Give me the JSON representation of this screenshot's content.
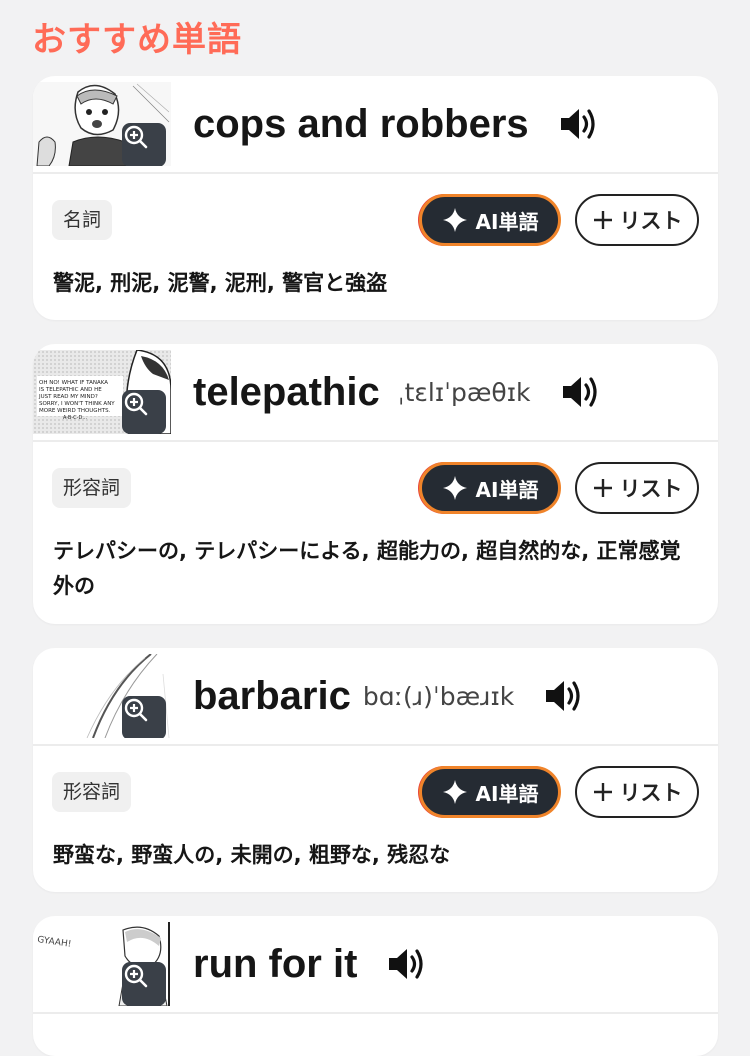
{
  "section": {
    "title": "おすすめ単語"
  },
  "cards": [
    {
      "word": "cops and robbers",
      "ipa": "",
      "pos": "名詞",
      "ai_label": "AI単語",
      "list_label": "リスト",
      "meaning": "警泥, 刑泥, 泥警, 泥刑, 警官と強盗"
    },
    {
      "word": "telepathic",
      "ipa": "ˌtɛlɪˈpæθɪk",
      "pos": "形容詞",
      "ai_label": "AI単語",
      "list_label": "リスト",
      "meaning": "テレパシーの, テレパシーによる, 超能力の, 超自然的な, 正常感覚外の",
      "thumb_text": "OH NO! WHAT IF TANAKA IS TELEPATHIC AND HE JUST READ MY MIND? SORRY, I WON'T THINK ANY MORE WEIRD THOUGHTS. A-B-C-D..."
    },
    {
      "word": "barbaric",
      "ipa": "bɑː(ɹ)ˈbæɹɪk",
      "pos": "形容詞",
      "ai_label": "AI単語",
      "list_label": "リスト",
      "meaning": "野蛮な, 野蛮人の, 未開の, 粗野な, 残忍な"
    },
    {
      "word": "run for it",
      "ipa": "",
      "pos": "",
      "ai_label": "",
      "list_label": "",
      "meaning": "",
      "thumb_text": "GYAAH!"
    }
  ],
  "icons": {
    "zoom": "zoom-in-icon",
    "speaker": "speaker-icon",
    "sparkle": "sparkle-icon",
    "plus": "plus-icon"
  },
  "colors": {
    "accent": "#ff6b57",
    "ai_button_bg": "#252b33",
    "ai_button_border": "#f0842a"
  }
}
